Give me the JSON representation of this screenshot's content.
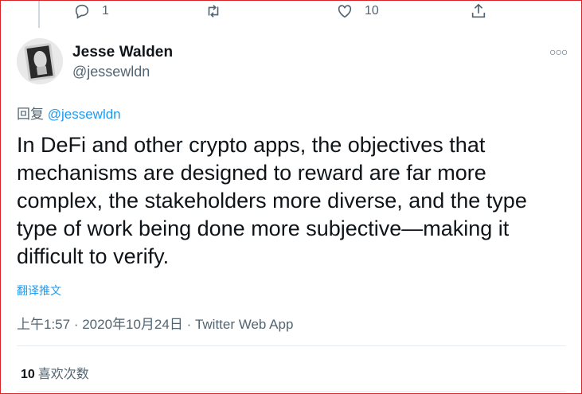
{
  "top_actions": {
    "reply_count": "1",
    "retweet_count": "",
    "like_count": "10",
    "icons": [
      "reply-icon",
      "retweet-icon",
      "like-icon",
      "share-icon"
    ]
  },
  "author": {
    "display_name": "Jesse Walden",
    "handle": "@jessewldn"
  },
  "reply_to": {
    "prefix": "回复",
    "handle": "@jessewldn"
  },
  "tweet": {
    "text": "In DeFi and other crypto apps, the objectives that mechanisms are designed to reward are far more complex, the stakeholders more diverse, and the type type of work being done more subjective—making it difficult to verify.",
    "translate_label": "翻译推文"
  },
  "meta": {
    "time": "上午1:57",
    "separator": " · ",
    "date": "2020年10月24日",
    "source": "Twitter Web App"
  },
  "stats": {
    "likes_count": "10",
    "likes_label": "喜欢次数"
  },
  "colors": {
    "link": "#1d9bf0",
    "muted": "#536471",
    "text": "#0f1419",
    "frame_border": "#d9252a"
  }
}
